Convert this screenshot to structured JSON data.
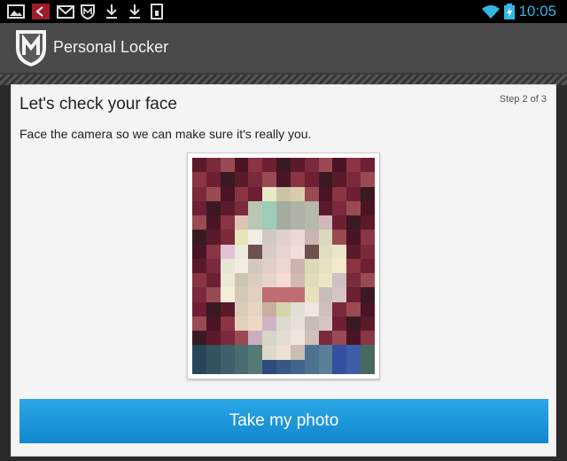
{
  "status_bar": {
    "time": "10:05",
    "icons": [
      "image-icon",
      "app-notification-icon",
      "gmail-icon",
      "mcafee-icon",
      "download-icon",
      "download-icon",
      "sd-card-icon",
      "wifi-icon",
      "battery-charging-icon"
    ]
  },
  "app_bar": {
    "logo_letter": "M",
    "title": "Personal Locker"
  },
  "main": {
    "step": "Step 2 of 3",
    "heading": "Let's check your face",
    "instruction": "Face the camera so we can make sure it's really you.",
    "photo_alt": "Pixelated face preview",
    "take_photo_label": "Take my photo"
  },
  "colors": {
    "accent": "#33b5e5",
    "button": "#1b96da",
    "app_bar": "#4a4a4a"
  }
}
